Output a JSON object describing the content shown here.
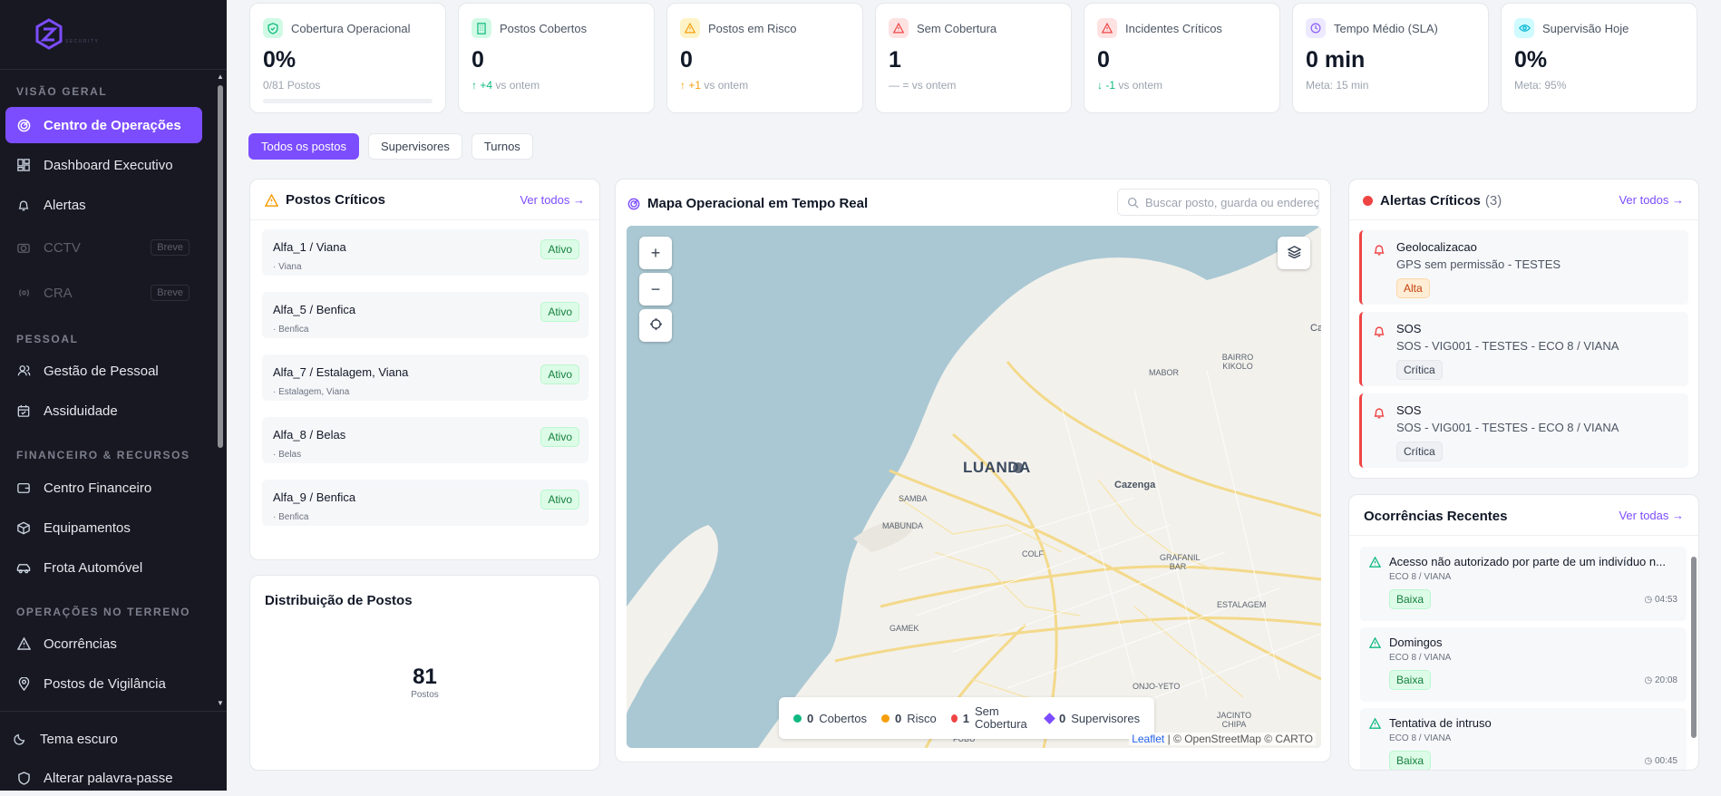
{
  "sidebar": {
    "logo_text": "SECURITY",
    "sections": [
      {
        "title": "VISÃO GERAL"
      },
      {
        "title": "PESSOAL"
      },
      {
        "title": "FINANCEIRO & RECURSOS"
      },
      {
        "title": "OPERAÇÕES NO TERRENO"
      }
    ],
    "items": [
      {
        "label": "Centro de Operações",
        "icon": "radar-icon"
      },
      {
        "label": "Dashboard Executivo",
        "icon": "grid-icon"
      },
      {
        "label": "Alertas",
        "icon": "bell-icon"
      },
      {
        "label": "CCTV",
        "icon": "camera-icon",
        "soon": "Breve"
      },
      {
        "label": "CRA",
        "icon": "radio-icon",
        "soon": "Breve"
      },
      {
        "label": "Gestão de Pessoal",
        "icon": "users-icon"
      },
      {
        "label": "Assiduidade",
        "icon": "calendar-icon"
      },
      {
        "label": "Centro Financeiro",
        "icon": "wallet-icon"
      },
      {
        "label": "Equipamentos",
        "icon": "box-icon"
      },
      {
        "label": "Frota Automóvel",
        "icon": "car-icon"
      },
      {
        "label": "Ocorrências",
        "icon": "warning-icon"
      },
      {
        "label": "Postos de Vigilância",
        "icon": "pin-icon"
      }
    ],
    "footer": [
      {
        "label": "Tema escuro",
        "icon": "moon-icon"
      },
      {
        "label": "Alterar palavra-passe",
        "icon": "shield-icon"
      }
    ]
  },
  "kpis": [
    {
      "label": "Cobertura Operacional",
      "value": "0%",
      "sub": "0/81 Postos",
      "progress": 0,
      "color": "#10b981"
    },
    {
      "label": "Postos Cobertos",
      "value": "0",
      "trend": "+4",
      "trend_text": "vs ontem",
      "color": "#10b981"
    },
    {
      "label": "Postos em Risco",
      "value": "0",
      "trend": "+1",
      "trend_text": "vs ontem",
      "color": "#f59e0b"
    },
    {
      "label": "Sem Cobertura",
      "value": "1",
      "trend": "=",
      "trend_text": "vs ontem",
      "color": "#ef4444"
    },
    {
      "label": "Incidentes Críticos",
      "value": "0",
      "trend": "-1",
      "trend_text": "vs ontem",
      "color": "#ef4444"
    },
    {
      "label": "Tempo Médio (SLA)",
      "value": "0 min",
      "sub": "Meta: 15 min",
      "color": "#8b5cf6"
    },
    {
      "label": "Supervisão Hoje",
      "value": "0%",
      "sub": "Meta: 95%",
      "color": "#06b6d4"
    }
  ],
  "tabs": [
    "Todos os postos",
    "Supervisores",
    "Turnos"
  ],
  "critical_posts": {
    "title": "Postos Críticos",
    "link": "Ver todos →",
    "items": [
      {
        "name": "Alfa_1 / Viana",
        "loc": "· Viana",
        "status": "Ativo"
      },
      {
        "name": "Alfa_5 / Benfica",
        "loc": "· Benfica",
        "status": "Ativo"
      },
      {
        "name": "Alfa_7 / Estalagem, Viana",
        "loc": "· Estalagem, Viana",
        "status": "Ativo"
      },
      {
        "name": "Alfa_8 / Belas",
        "loc": "· Belas",
        "status": "Ativo"
      },
      {
        "name": "Alfa_9 / Benfica",
        "loc": "· Benfica",
        "status": "Ativo"
      }
    ]
  },
  "distribution": {
    "title": "Distribuição de Postos",
    "total": "81",
    "unit": "Postos"
  },
  "map": {
    "title": "Mapa Operacional em Tempo Real",
    "search_placeholder": "Buscar posto, guarda ou endereço",
    "labels": [
      "LUANDA",
      "SAMBA",
      "MABUNDA",
      "Cazenga",
      "MABOR",
      "BAIRRO KIKOLO",
      "COLF",
      "GRAFANIL BAR",
      "ESTALAGEM",
      "GAMEK",
      "ONJO-YETO",
      "JACINTO CHIPA",
      "FUBU",
      "Ca"
    ],
    "legend": [
      {
        "count": "0",
        "label": "Cobertos",
        "color": "#10b981"
      },
      {
        "count": "0",
        "label": "Risco",
        "color": "#f59e0b"
      },
      {
        "count": "1",
        "label": "Sem Cobertura",
        "color": "#ef4444"
      },
      {
        "count": "0",
        "label": "Supervisores",
        "color": "#7c4dff"
      }
    ],
    "attribution_link": "Leaflet",
    "attribution": "| © OpenStreetMap © CARTO"
  },
  "alerts": {
    "title": "Alertas Críticos",
    "count": "(3)",
    "link": "Ver todos →",
    "items": [
      {
        "title": "Geolocalizacao",
        "desc": "GPS sem permissão - TESTES",
        "level": "Alta"
      },
      {
        "title": "SOS",
        "desc": "SOS - VIG001 - TESTES - ECO 8 / VIANA",
        "level": "Crítica"
      },
      {
        "title": "SOS",
        "desc": "SOS - VIG001 - TESTES - ECO 8 / VIANA",
        "level": "Crítica"
      }
    ]
  },
  "occurrences": {
    "title": "Ocorrências Recentes",
    "link": "Ver todas →",
    "items": [
      {
        "title": "Acesso não autorizado por parte de um indivíduo n...",
        "site": "ECO 8 / VIANA",
        "level": "Baixa",
        "time": "04:53"
      },
      {
        "title": "Domingos",
        "site": "ECO 8 / VIANA",
        "level": "Baixa",
        "time": "20:08"
      },
      {
        "title": "Tentativa de intruso",
        "site": "ECO 8 / VIANA",
        "level": "Baixa",
        "time": "00:45"
      }
    ]
  }
}
